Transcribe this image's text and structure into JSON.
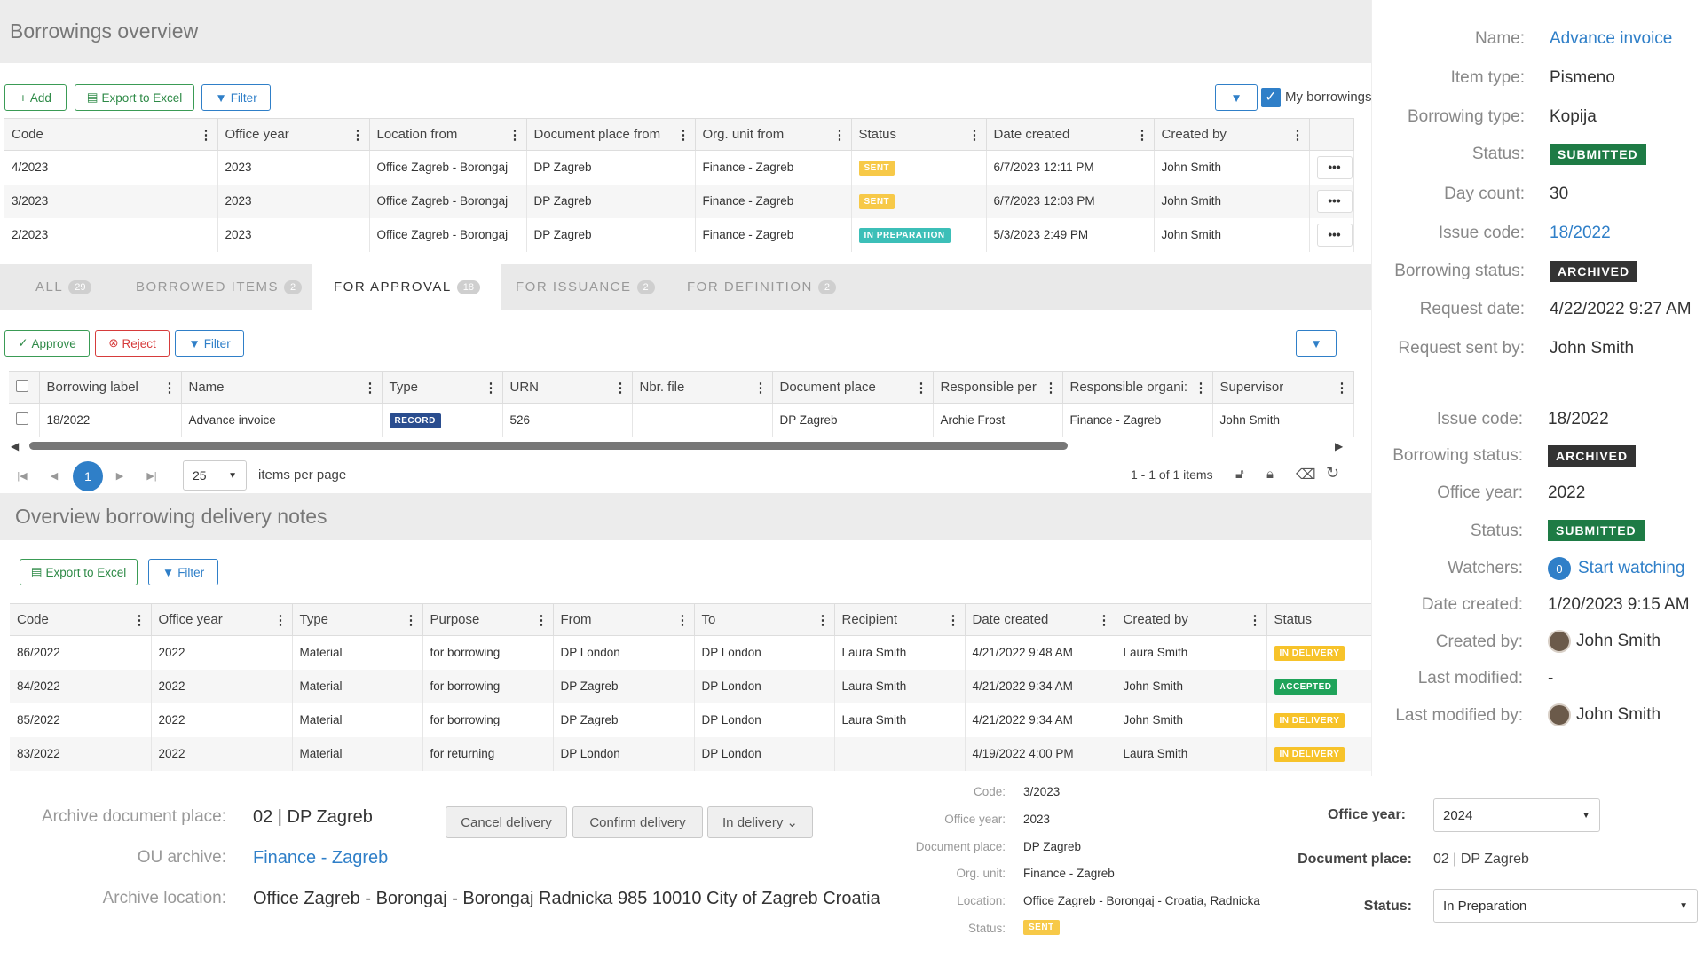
{
  "borrowings": {
    "title": "Borrowings overview",
    "add_label": "Add",
    "export_label": "Export to Excel",
    "filter_label": "Filter",
    "my_borrowings_label": "My borrowings",
    "columns": [
      "Code",
      "Office year",
      "Location from",
      "Document place from",
      "Org. unit from",
      "Status",
      "Date created",
      "Created by"
    ],
    "rows": [
      {
        "code": "4/2023",
        "year": "2023",
        "location": "Office Zagreb - Borongaj",
        "place": "DP Zagreb",
        "org": "Finance - Zagreb",
        "status": "SENT",
        "date": "6/7/2023 12:11 PM",
        "by": "John Smith"
      },
      {
        "code": "3/2023",
        "year": "2023",
        "location": "Office Zagreb - Borongaj",
        "place": "DP Zagreb",
        "org": "Finance - Zagreb",
        "status": "SENT",
        "date": "6/7/2023 12:03 PM",
        "by": "John Smith"
      },
      {
        "code": "2/2023",
        "year": "2023",
        "location": "Office Zagreb - Borongaj",
        "place": "DP Zagreb",
        "org": "Finance - Zagreb",
        "status": "IN PREPARATION",
        "date": "5/3/2023 2:49 PM",
        "by": "John Smith"
      }
    ],
    "more_label": "•••"
  },
  "tabs": [
    {
      "label": "ALL",
      "count": "29"
    },
    {
      "label": "BORROWED ITEMS",
      "count": "2"
    },
    {
      "label": "FOR APPROVAL",
      "count": "18"
    },
    {
      "label": "FOR ISSUANCE",
      "count": "2"
    },
    {
      "label": "FOR DEFINITION",
      "count": "2"
    }
  ],
  "approval": {
    "approve_label": "Approve",
    "reject_label": "Reject",
    "filter_label": "Filter",
    "columns": [
      "Borrowing label",
      "Name",
      "Type",
      "URN",
      "Nbr. file",
      "Document place",
      "Responsible per",
      "Responsible organi:",
      "Supervisor"
    ],
    "row": {
      "label": "18/2022",
      "name": "Advance invoice",
      "type": "RECORD",
      "urn": "526",
      "nbr": "",
      "place": "DP Zagreb",
      "person": "Archie Frost",
      "org": "Finance - Zagreb",
      "supervisor": "John Smith"
    },
    "page": "1",
    "page_size": "25",
    "items_per_page": "items per page",
    "range": "1 - 1 of 1 items"
  },
  "delivery": {
    "title": "Overview borrowing delivery notes",
    "export_label": "Export to Excel",
    "filter_label": "Filter",
    "columns": [
      "Code",
      "Office year",
      "Type",
      "Purpose",
      "From",
      "To",
      "Recipient",
      "Date created",
      "Created by",
      "Status"
    ],
    "rows": [
      {
        "code": "86/2022",
        "year": "2022",
        "type": "Material",
        "purpose": "for borrowing",
        "from": "DP London",
        "to": "DP London",
        "recipient": "Laura Smith",
        "date": "4/21/2022 9:48 AM",
        "by": "Laura Smith",
        "status": "IN DELIVERY"
      },
      {
        "code": "84/2022",
        "year": "2022",
        "type": "Material",
        "purpose": "for borrowing",
        "from": "DP Zagreb",
        "to": "DP London",
        "recipient": "Laura Smith",
        "date": "4/21/2022 9:34 AM",
        "by": "John Smith",
        "status": "ACCEPTED"
      },
      {
        "code": "85/2022",
        "year": "2022",
        "type": "Material",
        "purpose": "for borrowing",
        "from": "DP Zagreb",
        "to": "DP London",
        "recipient": "Laura Smith",
        "date": "4/21/2022 9:34 AM",
        "by": "John Smith",
        "status": "IN DELIVERY"
      },
      {
        "code": "83/2022",
        "year": "2022",
        "type": "Material",
        "purpose": "for returning",
        "from": "DP London",
        "to": "DP London",
        "recipient": "",
        "date": "4/19/2022 4:00 PM",
        "by": "Laura Smith",
        "status": "IN DELIVERY"
      }
    ]
  },
  "details": {
    "name_l": "Name:",
    "name_v": "Advance invoice",
    "item_type_l": "Item type:",
    "item_type_v": "Pismeno",
    "borrowing_type_l": "Borrowing type:",
    "borrowing_type_v": "Kopija",
    "status_l": "Status:",
    "status_v": "SUBMITTED",
    "day_count_l": "Day count:",
    "day_count_v": "30",
    "issue_code_l": "Issue code:",
    "issue_code_v": "18/2022",
    "borrowing_status_l": "Borrowing status:",
    "borrowing_status_v": "ARCHIVED",
    "request_date_l": "Request date:",
    "request_date_v": "4/22/2022 9:27 AM",
    "request_by_l": "Request sent by:",
    "request_by_v": "John Smith"
  },
  "details2": {
    "issue_code_l": "Issue code:",
    "issue_code_v": "18/2022",
    "borrowing_status_l": "Borrowing status:",
    "borrowing_status_v": "ARCHIVED",
    "office_year_l": "Office year:",
    "office_year_v": "2022",
    "status_l": "Status:",
    "status_v": "SUBMITTED",
    "watchers_l": "Watchers:",
    "watchers_count": "0",
    "watchers_v": "Start watching",
    "date_created_l": "Date created:",
    "date_created_v": "1/20/2023 9:15 AM",
    "created_by_l": "Created by:",
    "created_by_v": "John Smith",
    "last_modified_l": "Last modified:",
    "last_modified_v": "-",
    "last_modified_by_l": "Last modified by:",
    "last_modified_by_v": "John Smith"
  },
  "archive": {
    "place_l": "Archive document place:",
    "place_v": "02 | DP Zagreb",
    "ou_l": "OU archive:",
    "ou_v": "Finance - Zagreb",
    "location_l": "Archive location:",
    "location_v": "Office Zagreb - Borongaj - Borongaj Radnicka 985 10010 City of Zagreb Croatia",
    "cancel_label": "Cancel delivery",
    "confirm_label": "Confirm delivery",
    "in_delivery_label": "In delivery"
  },
  "code_detail": {
    "code_l": "Code:",
    "code_v": "3/2023",
    "year_l": "Office year:",
    "year_v": "2023",
    "place_l": "Document place:",
    "place_v": "DP Zagreb",
    "org_l": "Org. unit:",
    "org_v": "Finance - Zagreb",
    "loc_l": "Location:",
    "loc_v": "Office Zagreb - Borongaj - Croatia, Radnicka",
    "status_l": "Status:",
    "status_v": "SENT"
  },
  "form": {
    "year_l": "Office year:",
    "year_v": "2024",
    "place_l": "Document place:",
    "place_v": "02 | DP Zagreb",
    "status_l": "Status:",
    "status_v": "In Preparation"
  },
  "colors": {
    "green": "#1e7b45",
    "dark": "#333333",
    "link": "#2f7fc8"
  }
}
